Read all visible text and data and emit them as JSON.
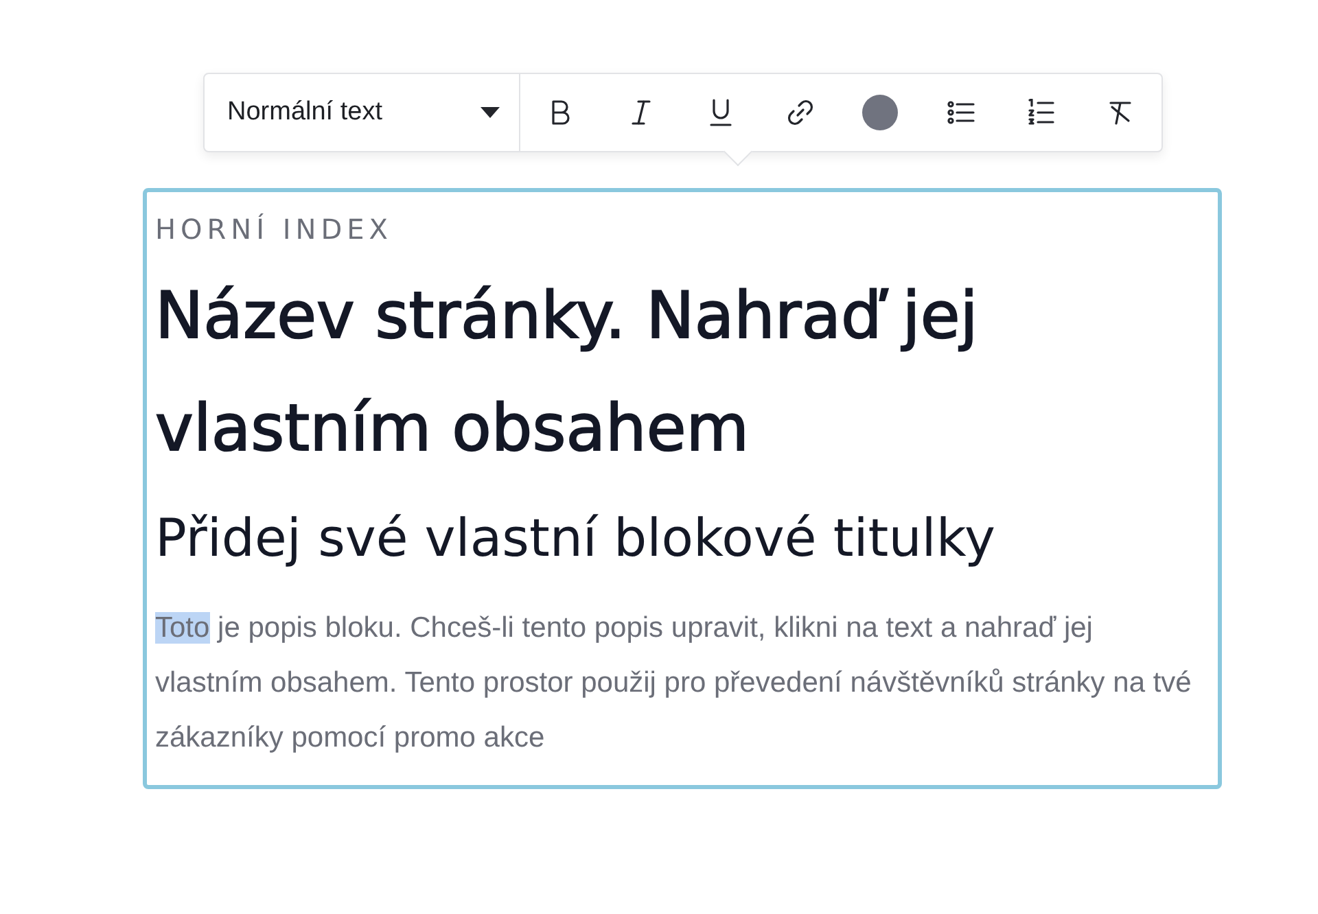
{
  "toolbar": {
    "style_dropdown": {
      "label": "Normální text"
    },
    "tools": [
      {
        "kind": "bold"
      },
      {
        "kind": "italic"
      },
      {
        "kind": "underline"
      },
      {
        "kind": "link"
      },
      {
        "kind": "color",
        "color": "#70737f"
      },
      {
        "kind": "bullet-list"
      },
      {
        "kind": "numbered-list"
      },
      {
        "kind": "clear-format"
      }
    ]
  },
  "block": {
    "overline": "HORNÍ INDEX",
    "title": "Název stránky. Nahraď jej vlastním obsahem",
    "subtitle": "Přidej své vlastní blokové titulky",
    "description": {
      "selected_text": "Toto",
      "text": " je popis bloku. Chceš-li tento popis upravit, klikni na text a nahraď jej vlastním obsahem. Tento prostor použij pro převedení návštěvníků stránky na tvé zákazníky pomocí promo akce"
    }
  }
}
